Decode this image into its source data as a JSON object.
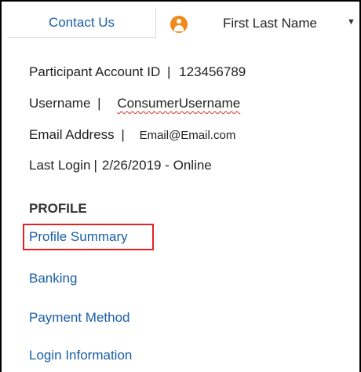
{
  "header": {
    "contact_label": "Contact Us",
    "user_name": "First Last Name",
    "caret_icon": "caret-down-icon",
    "avatar_icon": "user-avatar-icon",
    "accent_color": "#f08a1c",
    "link_color": "#1a5ea8"
  },
  "account": {
    "participant_label": "Participant Account ID",
    "participant_value": "123456789",
    "username_label": "Username",
    "username_value": "ConsumerUsername",
    "email_label": "Email Address",
    "email_value": "Email@Email.com",
    "last_login_label": "Last Login",
    "last_login_value": "2/26/2019 - Online",
    "separator": "|"
  },
  "profile": {
    "section_title": "PROFILE",
    "items": [
      {
        "label": "Profile Summary",
        "highlighted": true
      },
      {
        "label": "Banking"
      },
      {
        "label": "Payment Method"
      },
      {
        "label": "Login Information"
      }
    ],
    "highlight_color": "#e32222"
  }
}
